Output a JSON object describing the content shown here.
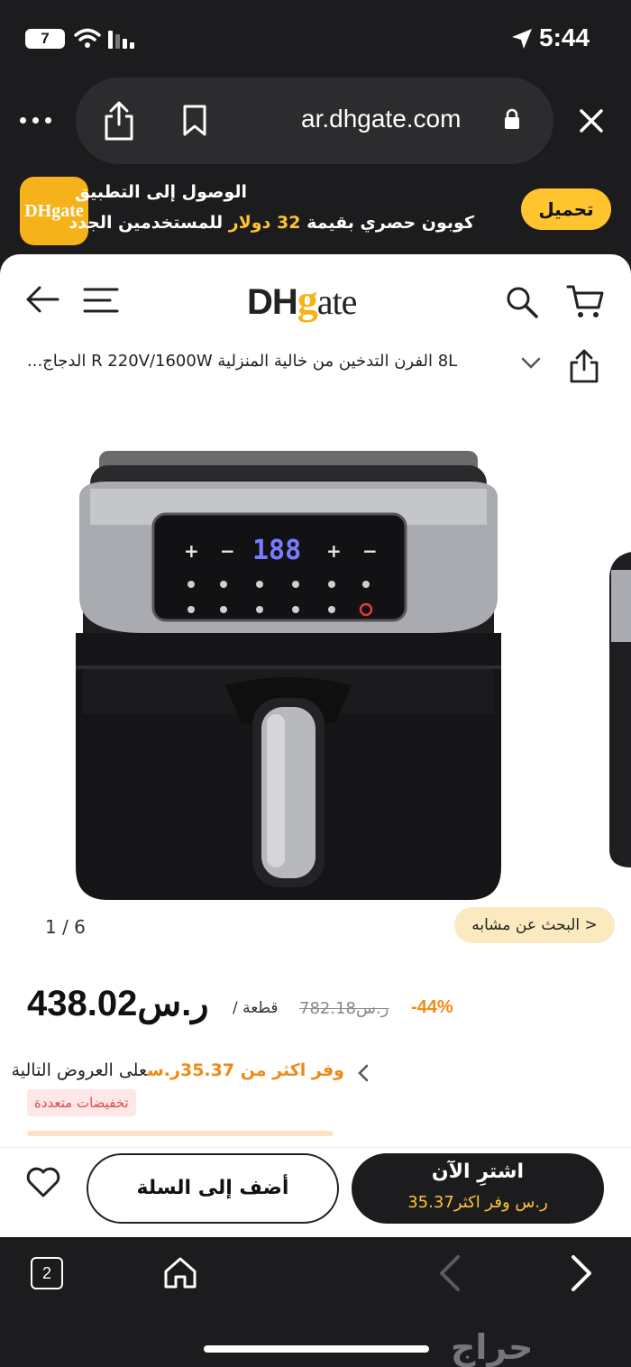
{
  "status_bar": {
    "battery": "7",
    "time": "5:44"
  },
  "browser": {
    "domain": "ar.dhgate.com"
  },
  "app_banner": {
    "line1": "الوصول إلى التطبيق",
    "line2_prefix": "كوبون حصري بقيمة",
    "line2_amount": "32 دولار",
    "line2_suffix": "للمستخدمين الجدد",
    "download_label": "تحميل",
    "logo_text": "DHgate"
  },
  "header": {
    "logo_dh": "DH",
    "logo_g": "g",
    "logo_ate": "ate"
  },
  "product": {
    "title": "8L الفرن التدخين من خالية المنزلية R 220V/1600W الدجاج...",
    "pager": "1 / 6",
    "similar_label": "< البحث عن مشابه",
    "display_digits": "188",
    "price": "438.02ر.س",
    "unit": "قطعة /",
    "old_price": "782.18ر.س",
    "discount": "-44%",
    "offer_highlight": "وفر اكثر من 35.37ر.س",
    "offer_rest": "على العروض التالية",
    "tag": "تخفيضات متعددة"
  },
  "actions": {
    "add_to_cart": "أضف إلى السلة",
    "buy_now": "اشترِ الآن",
    "buy_sub": "ر.س وفر اكثر35.37"
  },
  "toolbar": {
    "tab_count": "2"
  },
  "watermark": "حراج",
  "colors": {
    "accent": "#ffc42e",
    "discount": "#f08a16",
    "dark": "#1c1c1e"
  }
}
